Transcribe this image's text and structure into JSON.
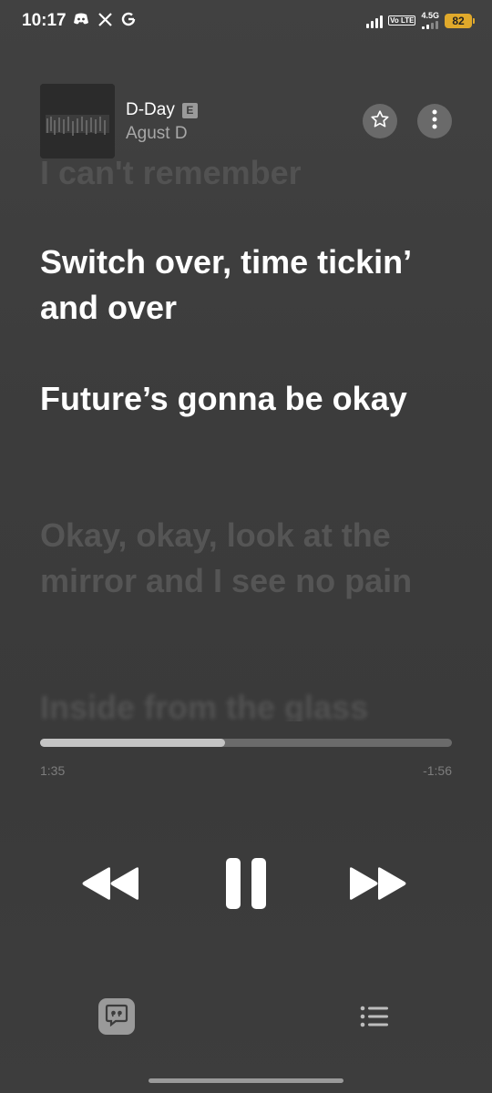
{
  "status_bar": {
    "time": "10:17",
    "icons_left": [
      "discord-icon",
      "x-icon",
      "google-icon"
    ],
    "volte_label": "Vo LTE",
    "network_label": "4.5G",
    "battery_level": "82"
  },
  "song": {
    "title": "D-Day",
    "explicit_badge": "E",
    "artist": "Agust D"
  },
  "lyrics": {
    "previous_line": "I can't remember",
    "active_lines": [
      "Switch over, time tickin’ and over",
      "Future’s gonna be okay"
    ],
    "upcoming_line": "Okay, okay, look at the mirror and I see no pain",
    "next_blurred_line": "Inside from the glass"
  },
  "playback": {
    "elapsed": "1:35",
    "remaining": "-1:56",
    "progress_fraction": 0.45
  },
  "colors": {
    "accent_battery": "#e0a92b",
    "progress_fill": "#c4c4c4",
    "progress_track": "#6b6b6b"
  }
}
